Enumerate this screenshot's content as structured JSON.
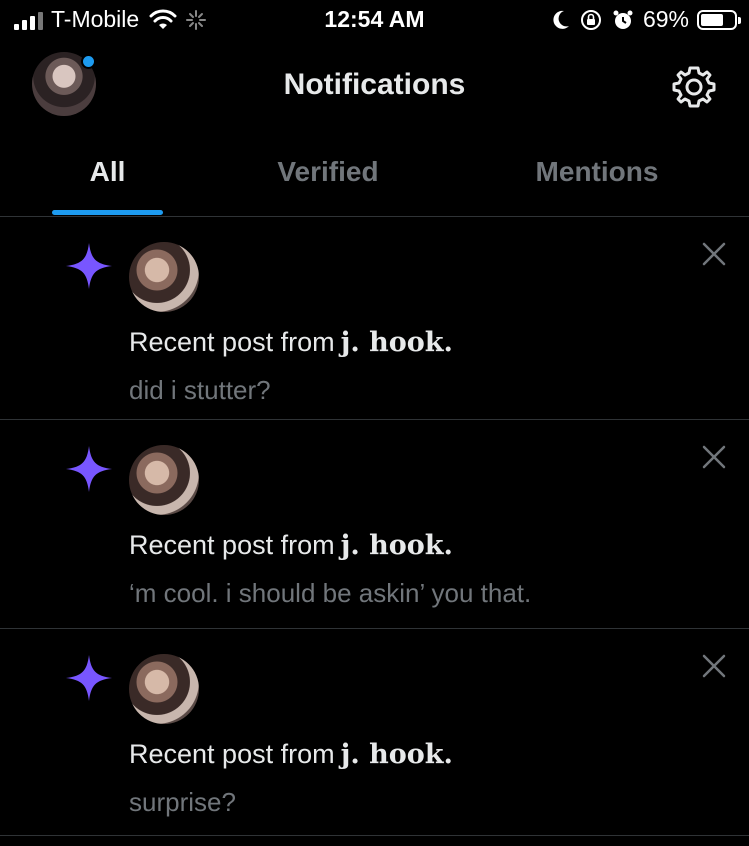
{
  "status_bar": {
    "carrier": "T-Mobile",
    "time": "12:54 AM",
    "battery": "69%",
    "battery_level": 0.69
  },
  "header": {
    "title": "Notifications"
  },
  "tabs": [
    {
      "label": "All",
      "active": true
    },
    {
      "label": "Verified",
      "active": false
    },
    {
      "label": "Mentions",
      "active": false
    }
  ],
  "notifications": [
    {
      "prefix": "Recent post from",
      "name": "j. hook.",
      "body": "did i stutter?"
    },
    {
      "prefix": "Recent post from",
      "name": "j. hook.",
      "body": "‘m cool. i should be askin’ you that."
    },
    {
      "prefix": "Recent post from",
      "name": "j. hook.",
      "body": "surprise?"
    }
  ],
  "colors": {
    "accent": "#1d9bf0",
    "star": "#7856ff",
    "background": "#000000",
    "muted_text": "#71767b"
  }
}
